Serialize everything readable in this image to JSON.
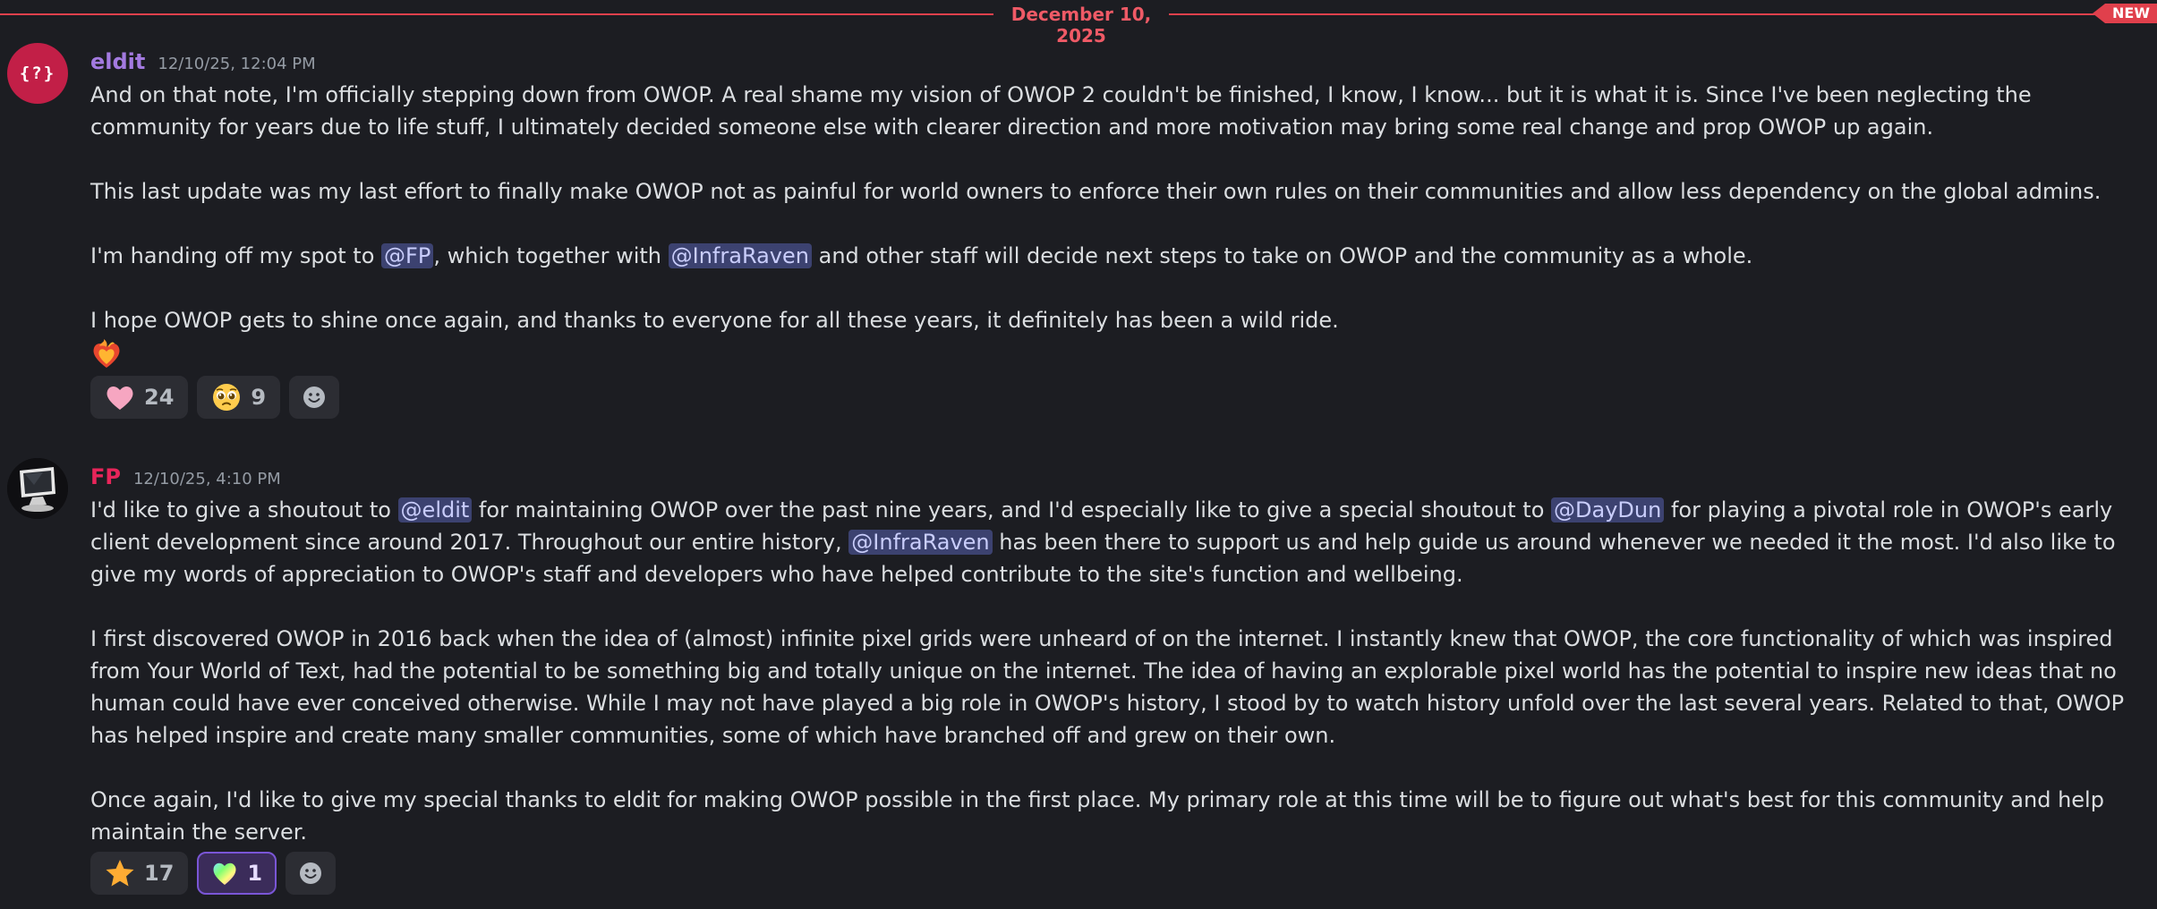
{
  "divider": {
    "date": "December 10, 2025",
    "new_label": "NEW",
    "color": "#e0404c"
  },
  "messages": [
    {
      "avatar_text": "{?}",
      "avatar_color": "#c21f47",
      "username": "eldit",
      "username_color": "#a37ae0",
      "timestamp": "12/10/25, 12:04 PM",
      "p1": "And on that note, I'm officially stepping down from OWOP. A real shame my vision of OWOP 2 couldn't be finished, I know, I know... but it is what it is. Since I've been neglecting the community for years due to life stuff, I ultimately decided someone else with clearer direction and more motivation may bring some real change and prop OWOP up again.",
      "p2": "This last update was my last effort to finally make OWOP not as painful for world owners to enforce their own rules on their communities and allow less dependency on the global admins.",
      "p3_a": "I'm handing off my spot to ",
      "p3_mention1": "@FP",
      "p3_b": ", which together with ",
      "p3_mention2": "@InfraRaven",
      "p3_c": " and other staff will decide next steps to take on OWOP and the community as a whole.",
      "p4": "I hope OWOP gets to shine once again, and thanks to everyone for all these years, it definitely has been a wild ride.",
      "emoji": "heart-on-fire-icon",
      "reactions": [
        {
          "icon": "pink-heart-icon",
          "count": "24"
        },
        {
          "icon": "pleading-face-icon",
          "count": "9"
        },
        {
          "icon": "add-reaction-icon"
        }
      ]
    },
    {
      "avatar_icon": "computer-monitor-icon",
      "username": "FP",
      "username_color": "#e8255a",
      "timestamp": "12/10/25, 4:10 PM",
      "p1_a": "I'd like to give a shoutout to ",
      "p1_mention1": "@eldit",
      "p1_b": " for maintaining OWOP over the past nine years, and I'd especially like to give a special shoutout to ",
      "p1_mention2": "@DayDun",
      "p1_c": " for playing a pivotal role in OWOP's early client development since around 2017. Throughout our entire history, ",
      "p1_mention3": "@InfraRaven",
      "p1_d": " has been there to support us and help guide us around whenever we needed it the most. I'd also like to give my words of appreciation to OWOP's staff and developers who have helped contribute to the site's function and wellbeing.",
      "p2": "I first discovered OWOP in 2016 back when the idea of (almost) infinite pixel grids were unheard of on the internet. I instantly knew that OWOP, the core functionality of which was inspired from Your World of Text, had the potential to be something big and totally unique on the internet. The idea of having an explorable pixel world has the potential to inspire new ideas that no human could have ever conceived otherwise. While I may not have played a big role in OWOP's history, I stood by to watch history unfold over the last several years. Related to that, OWOP has helped inspire and create many smaller communities, some of which have branched off and grew on their own.",
      "p3": "Once again, I'd like to give my special thanks to eldit for making OWOP possible in the first place. My primary role at this time will be to figure out what's best for this community and help maintain the server.",
      "reactions": [
        {
          "icon": "star-icon",
          "count": "17"
        },
        {
          "icon": "rainbow-heart-icon",
          "count": "1",
          "active": true
        },
        {
          "icon": "add-reaction-icon"
        }
      ]
    }
  ]
}
